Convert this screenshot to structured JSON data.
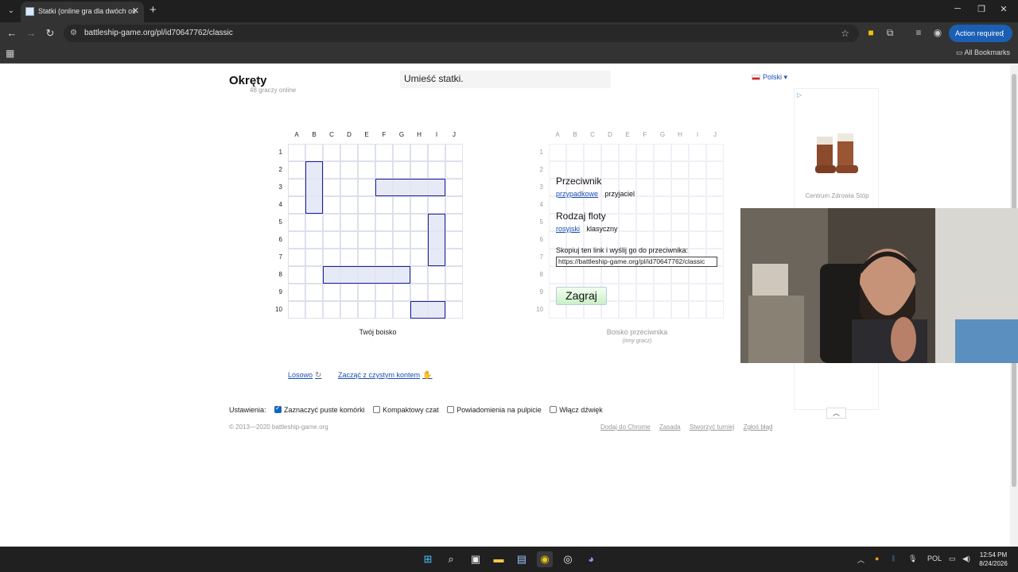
{
  "browser": {
    "tab_title": "Statki (online gra dla dwóch os",
    "url": "battleship-game.org/pl/id70647762/classic",
    "action_required": "Action required",
    "bookmarks_label": "All Bookmarks"
  },
  "header": {
    "logo": "Okręty",
    "online_count": "48 graczy online",
    "notice": "Umieść statki.",
    "language": "Polski ▾"
  },
  "boards": {
    "columns": [
      "A",
      "B",
      "C",
      "D",
      "E",
      "F",
      "G",
      "H",
      "I",
      "J"
    ],
    "rows": [
      "1",
      "2",
      "3",
      "4",
      "5",
      "6",
      "7",
      "8",
      "9",
      "10"
    ],
    "my_caption": "Twój boisko",
    "opponent_caption": "Boisko przeciwnika",
    "opponent_sub": "(inny gracz)"
  },
  "ships": [
    {
      "col": "B",
      "row": 2,
      "length": 3,
      "orientation": "vertical"
    },
    {
      "col": "F",
      "row": 3,
      "length": 4,
      "orientation": "horizontal"
    },
    {
      "col": "I",
      "row": 5,
      "length": 3,
      "orientation": "vertical"
    },
    {
      "col": "C",
      "row": 8,
      "length": 5,
      "orientation": "horizontal"
    },
    {
      "col": "H",
      "row": 10,
      "length": 2,
      "orientation": "horizontal"
    }
  ],
  "opponent_panel": {
    "opponent_heading": "Przeciwnik",
    "opponent_random": "przypadkowe",
    "opponent_friend": "przyjaciel",
    "fleet_heading": "Rodzaj floty",
    "fleet_russian": "rosyjski",
    "fleet_classic": "klasyczny",
    "copy_text": "Skopiuj ten link i wyślij go do przeciwnika:",
    "link": "https://battleship-game.org/pl/id70647762/classic",
    "play_button": "Zagraj"
  },
  "actions": {
    "random": "Losowo",
    "clear": "Zacząć z czystym kontem"
  },
  "settings": {
    "label": "Ustawienia:",
    "options": [
      {
        "label": "Zaznaczyć puste komórki",
        "checked": true
      },
      {
        "label": "Kompaktowy czat",
        "checked": false
      },
      {
        "label": "Powiadomienia na pulpicie",
        "checked": false
      },
      {
        "label": "Włącz dźwięk",
        "checked": false
      }
    ]
  },
  "footer": {
    "copyright": "© 2013—2020 battleship-game.org",
    "links": [
      "Dodaj do Chrome",
      "Zasada",
      "Stworzyć turniej",
      "Zgłoś błąd"
    ]
  },
  "ad": {
    "caption": "Centrum Zdrowia Stóp"
  },
  "taskbar": {
    "language": "POL",
    "time": "12:54 PM",
    "date": "8/24/2026"
  }
}
